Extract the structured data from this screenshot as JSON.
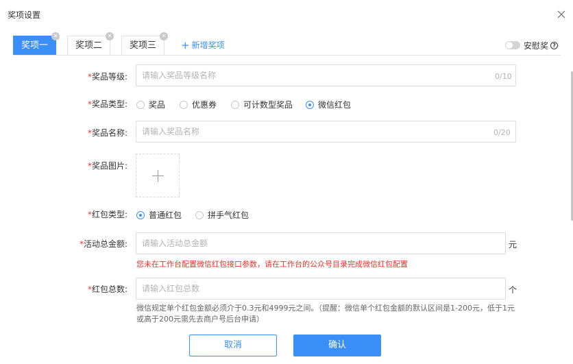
{
  "dialog": {
    "title": "奖项设置"
  },
  "tabs": [
    {
      "label": "奖项一",
      "active": true
    },
    {
      "label": "奖项二",
      "active": false
    },
    {
      "label": "奖项三",
      "active": false
    }
  ],
  "add_tab_label": "新增奖项",
  "consolation": {
    "label": "安慰奖",
    "enabled": false
  },
  "form": {
    "level": {
      "label": "奖品等级:",
      "placeholder": "请输入奖品等级名称",
      "counter": "0/10"
    },
    "type": {
      "label": "奖品类型:",
      "options": [
        "奖品",
        "优惠券",
        "可计数型奖品",
        "微信红包"
      ],
      "selected": "微信红包"
    },
    "name": {
      "label": "奖品名称:",
      "placeholder": "请输入奖品名称",
      "counter": "0/20"
    },
    "image": {
      "label": "奖品图片:"
    },
    "redpacket_type": {
      "label": "红包类型:",
      "options": [
        "普通红包",
        "拼手气红包"
      ],
      "selected": "普通红包"
    },
    "total_amount": {
      "label": "活动总金额:",
      "placeholder": "请输入活动总金额",
      "unit": "元",
      "error": "您未在工作台配置微信红包接口参数，请在工作台的公众号目录完成微信红包配置"
    },
    "total_count": {
      "label": "红包总数:",
      "placeholder": "请输入红包总数",
      "unit": "个",
      "hint": "微信规定单个红包金额必须介于0.3元和4999元之间。（提醒：微信单个红包金额的默认区间是1-200元，低于1元或高于200元需先去商户号后台申请）"
    }
  },
  "buttons": {
    "cancel": "取消",
    "confirm": "确认"
  },
  "colors": {
    "primary": "#3a8ff7",
    "required": "#ee3333",
    "error": "#e5332a"
  }
}
